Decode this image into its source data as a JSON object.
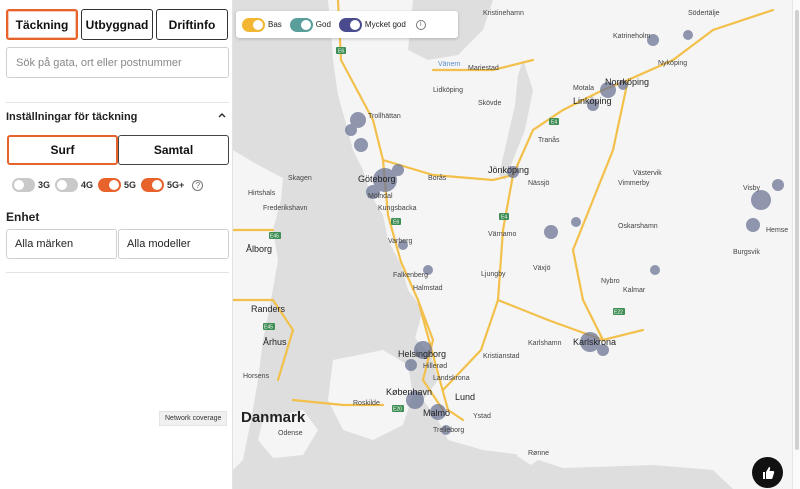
{
  "sidebar": {
    "tabs": [
      {
        "label": "Täckning",
        "active": true
      },
      {
        "label": "Utbyggnad",
        "active": false
      },
      {
        "label": "Driftinfo",
        "active": false
      }
    ],
    "search_placeholder": "Sök på gata, ort eller postnummer",
    "settings_title": "Inställningar för täckning",
    "modes": [
      {
        "label": "Surf",
        "active": true
      },
      {
        "label": "Samtal",
        "active": false
      }
    ],
    "toggles": [
      {
        "label": "3G",
        "on": false
      },
      {
        "label": "4G",
        "on": false
      },
      {
        "label": "5G",
        "on": true
      },
      {
        "label": "5G+",
        "on": true
      }
    ],
    "help_glyph": "?",
    "unit_title": "Enhet",
    "brand_select": "Alla märken",
    "model_select": "Alla modeller",
    "tooltip": "Network coverage"
  },
  "legend": {
    "items": [
      {
        "label": "Bas",
        "color": "#f2b632"
      },
      {
        "label": "God",
        "color": "#5a9e9c"
      },
      {
        "label": "Mycket god",
        "color": "#4a4a8e"
      }
    ],
    "info_glyph": "i"
  },
  "map": {
    "country": "Danmark",
    "cities": [
      "Göteborg",
      "Linköping",
      "Norrköping",
      "Jönköping",
      "Helsingborg",
      "København",
      "Malmö",
      "Lund",
      "Karlskrona",
      "Ålborg",
      "Århus",
      "Randers",
      "Odense",
      "Halmstad",
      "Kalmar",
      "Växjö",
      "Västervik",
      "Trollhättan",
      "Borås",
      "Varberg",
      "Falkenberg",
      "Kristianstad",
      "Motala",
      "Nyköping",
      "Södertälje",
      "Kristinehamn",
      "Mariestad",
      "Lidköping",
      "Skövde",
      "Tranås",
      "Nässjö",
      "Vimmerby",
      "Oskarshamn",
      "Värnamo",
      "Ljungby",
      "Nybro",
      "Karlshamn",
      "Landskrona",
      "Ystad",
      "Trelleborg",
      "Skagen",
      "Hirtshals",
      "Frederikshavn",
      "Kungsbacka",
      "Mölndal",
      "Horsens",
      "Roskilde",
      "Hillerød",
      "Rønne",
      "Visby",
      "Hemse",
      "Burgsvik",
      "Katrineholm",
      "Vänern",
      "Kristianstad"
    ],
    "roads": [
      "E6",
      "E4",
      "E20",
      "E22",
      "E45",
      "E18",
      "E65",
      "E39"
    ]
  }
}
